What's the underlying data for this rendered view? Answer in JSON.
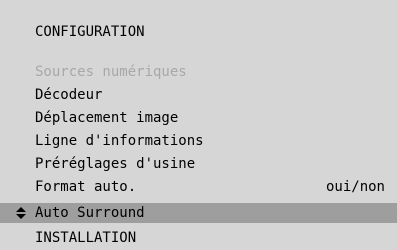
{
  "menu": {
    "title": "CONFIGURATION",
    "items": [
      {
        "label": "Sources numériques",
        "value": "",
        "state": "disabled"
      },
      {
        "label": "Décodeur",
        "value": "",
        "state": "normal"
      },
      {
        "label": "Déplacement image",
        "value": "",
        "state": "normal"
      },
      {
        "label": "Ligne d'informations",
        "value": "",
        "state": "normal"
      },
      {
        "label": "Préréglages d'usine",
        "value": "",
        "state": "normal"
      },
      {
        "label": "Format auto.",
        "value": "oui/non",
        "state": "normal"
      },
      {
        "label": "Auto Surround",
        "value": "",
        "state": "selected"
      },
      {
        "label": "INSTALLATION",
        "value": "",
        "state": "normal"
      }
    ]
  },
  "icons": {
    "selection": "up-down-arrows-icon"
  },
  "colors": {
    "background": "#d6d6d6",
    "selection_bar": "#9e9e9e",
    "disabled_text": "#a8a8a8",
    "text": "#000000"
  }
}
